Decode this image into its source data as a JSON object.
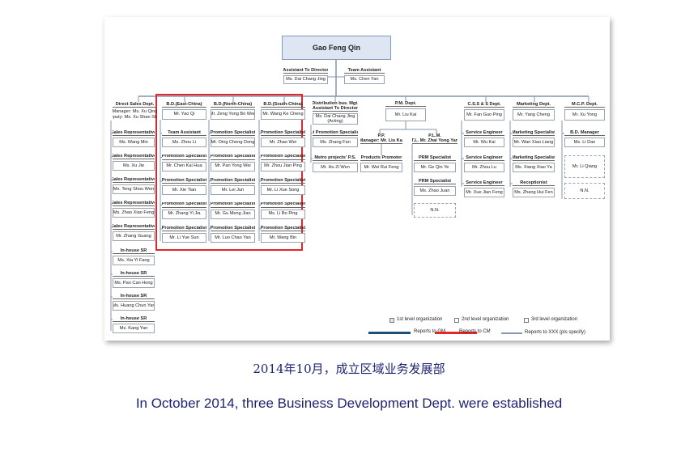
{
  "director": "Gao Feng Qin",
  "assistants": [
    {
      "title": "Assistant To Director",
      "name": "Ms. Dai Chang Jing"
    },
    {
      "title": "Team Assistant",
      "name": "Ms. Chen Yan"
    }
  ],
  "depts": {
    "direct_sales": {
      "header": "Direct Sales Dept.",
      "manager": "Manager: Ms. Xu Qing\nDeputy: Ms. Xu Shan Shan",
      "reps": [
        {
          "title": "Sales Representative",
          "name": "Ms. Wang Min"
        },
        {
          "title": "Sales Representative",
          "name": "Ms. Xu Jie"
        },
        {
          "title": "Sales Representative",
          "name": "Ms. Teng Shou Wen"
        },
        {
          "title": "Sales Representative",
          "name": "Ms. Zhao Xiao Feng"
        },
        {
          "title": "Sales Representative",
          "name": "Mr. Zhang Guang"
        }
      ],
      "inhouse": [
        {
          "title": "In-house SR",
          "name": "Ms. Xia Yi Fang"
        },
        {
          "title": "In-house SR",
          "name": "Ms. Pan Can Hong"
        },
        {
          "title": "In-house SR",
          "name": "Ms. Huang Chun Yan"
        },
        {
          "title": "In-house SR",
          "name": "Ms. Kang Yan"
        }
      ]
    },
    "bd_east": {
      "header": "B.D.(East-China)",
      "manager": "Mr. Yao Qi",
      "staff": [
        {
          "title": "Team Assistant",
          "name": "Ms. Zhou Li"
        },
        {
          "title": "Promotion Specialist",
          "name": "Mr. Chen Kai Hua"
        },
        {
          "title": "Promotion Specialist",
          "name": "Mr. Xie Tian"
        },
        {
          "title": "Promotion Specialist",
          "name": "Mr. Zhang Yi Jia"
        },
        {
          "title": "Promotion Specialist",
          "name": "Mr. Li Yue Sun"
        }
      ]
    },
    "bd_north": {
      "header": "B.D.(North-China)",
      "manager": "Mr. Zeng Yong Bo Wen",
      "staff": [
        {
          "title": "Promotion Specialist",
          "name": "Mr. Ding Cheng Dong"
        },
        {
          "title": "Promotion Specialist",
          "name": "Mr. Pan Yong Wei"
        },
        {
          "title": "Promotion Specialist",
          "name": "Mr. Lei Jun"
        },
        {
          "title": "Promotion Specialist",
          "name": "Mr. Gu Meng Jiao"
        },
        {
          "title": "Promotion Specialist",
          "name": "Mr. Luo Chao Yan"
        }
      ]
    },
    "bd_south": {
      "header": "B.D.(South-China)",
      "manager": "Mr. Wang Ke Cheng",
      "staff": [
        {
          "title": "Promotion Specialist",
          "name": "Mr. Zhao Wei"
        },
        {
          "title": "Promotion Specialist",
          "name": "Mr. Zhou Jian Ping"
        },
        {
          "title": "Promotion Specialist",
          "name": "Mr. Li Xue Song"
        },
        {
          "title": "Promotion Specialist",
          "name": "Ms. Li Bo Ping"
        },
        {
          "title": "Promotion Specialist",
          "name": "Mr. Wang Bin"
        }
      ]
    },
    "distribution": {
      "header": "Distribution bus. Mgt.\nAssistant To Director",
      "manager": "Ms. Dai Chang Jing\n(Acting)",
      "staff": [
        {
          "title": "Di Promotion Specialist",
          "name": "Ms. Zhang Fan"
        },
        {
          "title": "Metro projects' P.S.",
          "name": "Mr. Hu Zi Wen"
        }
      ]
    },
    "pm": {
      "header": "P.M. Dept.",
      "manager": "Mr. Liu Kai",
      "pp": "P.P.\nManager: Mr. Liu Kai",
      "plm": "P.L.M.\nT.L. Mr. Zhai Yong Yan",
      "products_promoter": {
        "title": "Products Promoter",
        "name": "Mr. Wei Rui Feng"
      },
      "prm": [
        {
          "title": "PRM Specialist",
          "name": "Mr. Ge Qin Ye"
        },
        {
          "title": "PRM Specialist",
          "name": "Ms. Zhao Juan"
        }
      ],
      "nn": "N.N."
    },
    "css": {
      "header": "C.S.S & S Dept.",
      "manager": "Mr. Fan Guo Ping",
      "staff": [
        {
          "title": "Service Engineer",
          "name": "Mr. Wu Kai"
        },
        {
          "title": "Service Engineer",
          "name": "Mr. Zhou Lu"
        },
        {
          "title": "Service Engineer",
          "name": "Mr. Xue Jian Feng"
        }
      ]
    },
    "marketing": {
      "header": "Marketing Dept.",
      "manager": "Mr. Yang Cheng",
      "staff": [
        {
          "title": "Marketing Specialist",
          "name": "Mr. Wan Xiao Liang"
        },
        {
          "title": "Marketing Specialist",
          "name": "Ms. Xiang Xiao Ya"
        },
        {
          "title": "Receptionist",
          "name": "Ms. Zhang Hui Fen"
        }
      ]
    },
    "mcp": {
      "header": "M.C.P. Dept.",
      "manager": "Mr. Xu Yong",
      "bd_manager": {
        "title": "B.D. Manager",
        "name": "Ms. Li Dan"
      },
      "staff": [
        "Mr. Li Qiang",
        "N.N."
      ]
    }
  },
  "legend": {
    "level1": "1st level organization",
    "level2": "2nd level organization",
    "level3": "3rd level organization",
    "gm": "Reports to GM",
    "cm": "Reports to CM",
    "xxx": "Reports to XXX (pls specify)"
  },
  "colors": {
    "gm": "#1f4e79",
    "cm": "#e3262b",
    "xxx": "#8496b0",
    "caption": "#1f2470"
  },
  "caption_cn": "2014年10月，成立区域业务发展部",
  "caption_en": "In October 2014, three Business Development Dept. were established"
}
